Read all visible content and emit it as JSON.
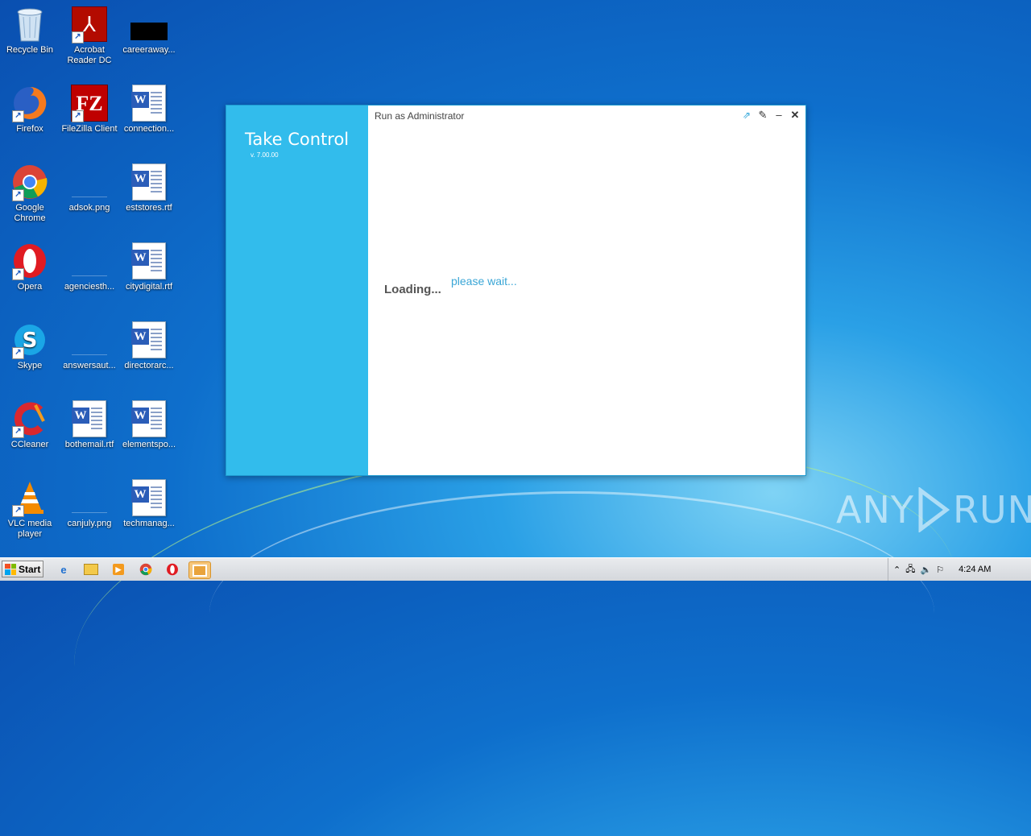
{
  "desktop": {
    "icons": [
      {
        "label": "Recycle Bin",
        "icon": "recycle-bin-icon"
      },
      {
        "label": "Acrobat Reader DC",
        "icon": "acrobat-icon"
      },
      {
        "label": "careeraway...",
        "icon": "black-image-icon"
      },
      {
        "label": "Firefox",
        "icon": "firefox-icon"
      },
      {
        "label": "FileZilla Client",
        "icon": "filezilla-icon"
      },
      {
        "label": "connection...",
        "icon": "word-doc-icon"
      },
      {
        "label": "Google Chrome",
        "icon": "chrome-icon"
      },
      {
        "label": "adsok.png",
        "icon": "png-file-icon"
      },
      {
        "label": "eststores.rtf",
        "icon": "word-doc-icon"
      },
      {
        "label": "Opera",
        "icon": "opera-icon"
      },
      {
        "label": "agenciesth...",
        "icon": "png-file-icon"
      },
      {
        "label": "citydigital.rtf",
        "icon": "word-doc-icon"
      },
      {
        "label": "Skype",
        "icon": "skype-icon"
      },
      {
        "label": "answersaut...",
        "icon": "png-file-icon"
      },
      {
        "label": "directorarc...",
        "icon": "word-doc-icon"
      },
      {
        "label": "CCleaner",
        "icon": "ccleaner-icon"
      },
      {
        "label": "bothemail.rtf",
        "icon": "word-doc-icon"
      },
      {
        "label": "elementspo...",
        "icon": "word-doc-icon"
      },
      {
        "label": "VLC media player",
        "icon": "vlc-icon"
      },
      {
        "label": "canjuly.png",
        "icon": "png-file-icon"
      },
      {
        "label": "techmanag...",
        "icon": "word-doc-icon"
      }
    ]
  },
  "window": {
    "app_title": "Take Control",
    "version": "v. 7.00.00",
    "header": "Run as Administrator",
    "loading": "Loading...",
    "wait": "please wait...",
    "accent": "#32bcec"
  },
  "taskbar": {
    "start_label": "Start",
    "clock": "4:24 AM"
  },
  "watermark": {
    "left": "ANY",
    "right": "RUN"
  }
}
